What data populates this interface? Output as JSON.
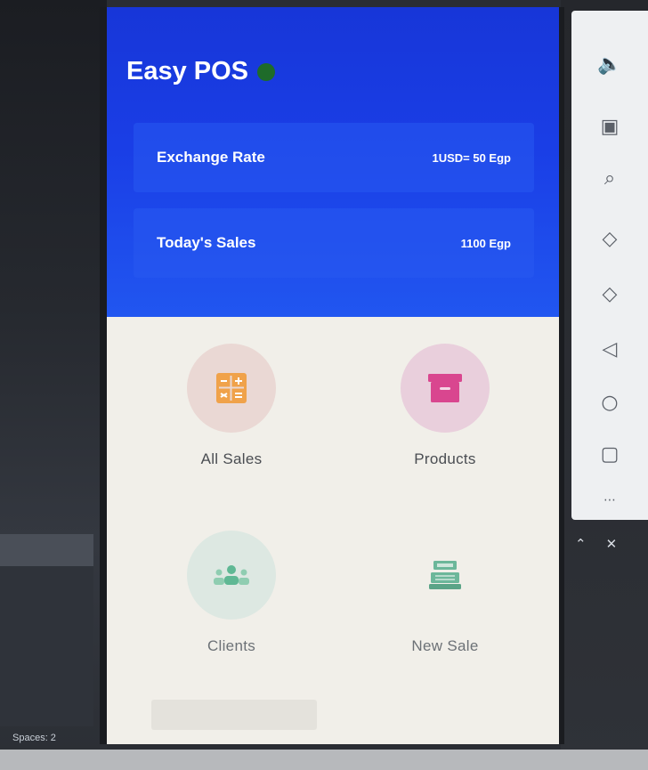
{
  "app": {
    "title": "Easy POS",
    "status_color": "#1e6b2a",
    "header_color": "#1a3ee6"
  },
  "cards": {
    "exchange": {
      "label": "Exchange Rate",
      "value": "1USD= 50 Egp"
    },
    "sales": {
      "label": "Today's Sales",
      "value": "1100 Egp"
    }
  },
  "menu": {
    "all_sales": {
      "label": "All Sales",
      "icon": "calculator-icon",
      "color": "#f0a24a"
    },
    "products": {
      "label": "Products",
      "icon": "archive-box-icon",
      "color": "#d9468f"
    },
    "clients": {
      "label": "Clients",
      "icon": "users-icon",
      "color": "#5fb894"
    },
    "new_sale": {
      "label": "New Sale",
      "icon": "cash-register-icon",
      "color": "#6cb79a"
    }
  },
  "editor": {
    "status": "Spaces: 2"
  }
}
